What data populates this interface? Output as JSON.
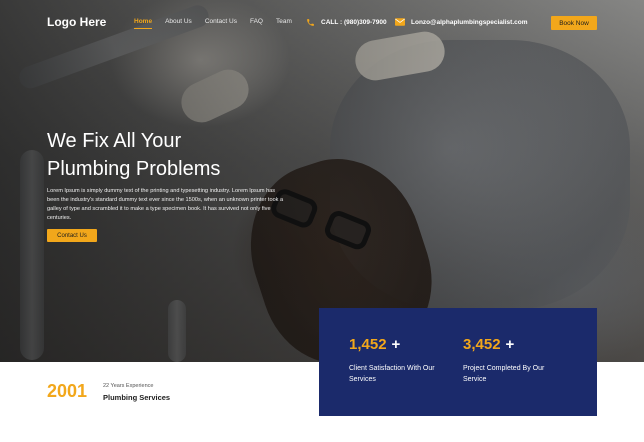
{
  "nav": {
    "logo": "Logo Here",
    "items": [
      {
        "label": "Home",
        "active": true
      },
      {
        "label": "About Us",
        "active": false
      },
      {
        "label": "Contact Us",
        "active": false
      },
      {
        "label": "FAQ",
        "active": false
      },
      {
        "label": "Team",
        "active": false
      }
    ],
    "phone": "CALL : (980)309-7900",
    "email": "Lonzo@alphaplumbingspecialist.com",
    "book_label": "Book Now"
  },
  "hero": {
    "title_line1": "We Fix All Your",
    "title_line2": "Plumbing Problems",
    "description": "Lorem Ipsum is simply dummy text of the printing and typesetting industry. Lorem Ipsum has been the industry's standard dummy text ever since the 1500s, when an unknown printer took a galley of type and scrambled it to make a type specimen book. It has survived not only five centuries.",
    "cta_label": "Contact Us"
  },
  "experience": {
    "year": "2001",
    "subtitle": "22 Years Experience",
    "title": "Plumbing Services"
  },
  "stats": [
    {
      "value": "1,452",
      "suffix": "+",
      "label": "Client Satisfaction With Our Services"
    },
    {
      "value": "3,452",
      "suffix": "+",
      "label": "Project Completed By Our Service"
    }
  ],
  "colors": {
    "accent": "#f2a71b",
    "navy": "#1b2a6b"
  },
  "icons": {
    "phone": "phone-icon",
    "email": "envelope-icon"
  }
}
